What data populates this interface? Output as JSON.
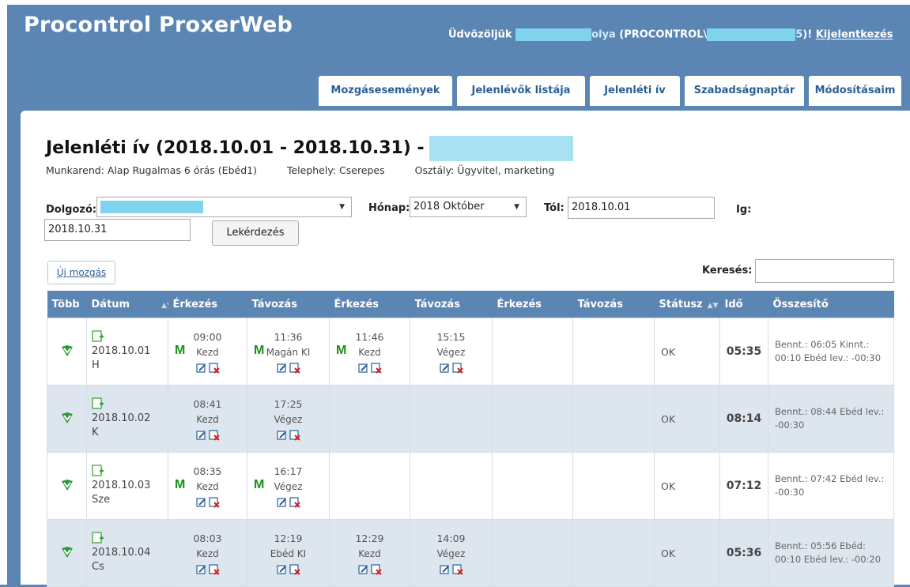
{
  "app": {
    "title": "Procontrol ProxerWeb"
  },
  "header": {
    "welcome_prefix": "Üdvözöljük",
    "welcome_name_suffix": "olya",
    "welcome_domain": "(PROCONTROL\\",
    "welcome_domain_suffix": "5",
    "welcome_end": ")!",
    "logout": "Kijelentkezés"
  },
  "tabs": [
    "Mozgásesemények",
    "Jelenlévők listája",
    "Jelenléti ív",
    "Szabadságnaptár",
    "Módosításaim"
  ],
  "page": {
    "title": "Jelenléti ív (2018.10.01 - 2018.10.31) -",
    "munkarend": "Munkarend: Alap Rugalmas 6 órás (Ebéd1)",
    "telephely": "Telephely: Cserepes",
    "osztaly": "Osztály: Ügyvitel, marketing"
  },
  "filters": {
    "dolgozo_label": "Dolgozó:",
    "honap_label": "Hónap:",
    "honap_value": "2018 Október",
    "tol_label": "Tól:",
    "tol_value": "2018.10.01",
    "ig_label": "Ig:",
    "ig_value": "2018.10.31",
    "query_button": "Lekérdezés"
  },
  "new_movement_button": "Új mozgás",
  "search_label": "Keresés:",
  "table": {
    "headers": {
      "tobb": "Több",
      "datum": "Dátum",
      "erkezes": "Érkezés",
      "tavozas": "Távozás",
      "statusz": "Státusz",
      "ido": "Idő",
      "osszesito": "Összesítő"
    },
    "rows": [
      {
        "date": "2018.10.01",
        "day": "H",
        "e1": {
          "time": "09:00",
          "label": "Kezd",
          "m": "M"
        },
        "t1": {
          "time": "11:36",
          "label": "Magán KI",
          "m": "M"
        },
        "e2": {
          "time": "11:46",
          "label": "Kezd",
          "m": "M"
        },
        "t2": {
          "time": "15:15",
          "label": "Végez",
          "m": ""
        },
        "status": "OK",
        "ido": "05:35",
        "summary": "Bennt.: 06:05 Kinnt.: 00:10 Ebéd lev.: -00:30"
      },
      {
        "date": "2018.10.02",
        "day": "K",
        "e1": {
          "time": "08:41",
          "label": "Kezd",
          "m": ""
        },
        "t1": {
          "time": "17:25",
          "label": "Végez",
          "m": ""
        },
        "status": "OK",
        "ido": "08:14",
        "summary": "Bennt.: 08:44 Ebéd lev.: -00:30"
      },
      {
        "date": "2018.10.03",
        "day": "Sze",
        "e1": {
          "time": "08:35",
          "label": "Kezd",
          "m": "M"
        },
        "t1": {
          "time": "16:17",
          "label": "Végez",
          "m": "M"
        },
        "status": "OK",
        "ido": "07:12",
        "summary": "Bennt.: 07:42 Ebéd lev.: -00:30"
      },
      {
        "date": "2018.10.04",
        "day": "Cs",
        "e1": {
          "time": "08:03",
          "label": "Kezd",
          "m": ""
        },
        "t1": {
          "time": "12:19",
          "label": "Ebéd KI",
          "m": ""
        },
        "e2": {
          "time": "12:29",
          "label": "Kezd",
          "m": ""
        },
        "t2": {
          "time": "14:09",
          "label": "Végez",
          "m": ""
        },
        "status": "OK",
        "ido": "05:36",
        "summary": "Bennt.: 05:56 Ebéd: 00:10 Ebéd lev.: -00:20"
      }
    ]
  },
  "colors": {
    "header_bg": "#5b86b4",
    "tab_text": "#2b5f95",
    "m_green": "#1a8f1a",
    "mask": "#7fd3ec"
  }
}
